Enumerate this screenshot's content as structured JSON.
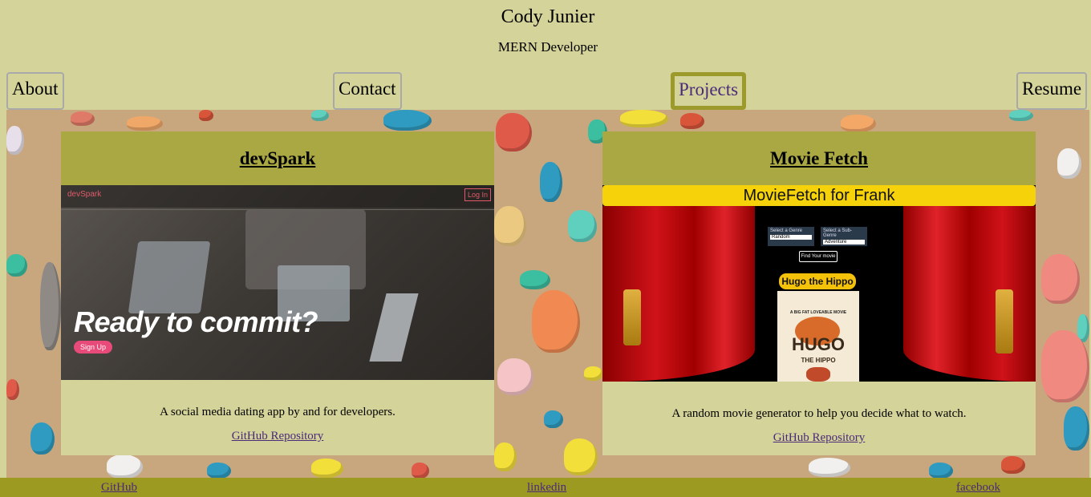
{
  "header": {
    "name": "Cody Junier",
    "role": "MERN Developer"
  },
  "nav": {
    "about": "About",
    "contact": "Contact",
    "projects": "Projects",
    "resume": "Resume"
  },
  "projects": [
    {
      "title": "devSpark",
      "image": {
        "logo": "devSpark",
        "login": "Log In",
        "headline": "Ready to commit?",
        "signup": "Sign Up"
      },
      "description": "A social media dating app by and for developers.",
      "link": "GitHub Repository"
    },
    {
      "title": "Movie Fetch",
      "image": {
        "banner": "MovieFetch for Frank",
        "genre_label": "Select a Genre",
        "genre_value": "Random",
        "subgenre_label": "Select a Sub-Genre",
        "subgenre_value": "Adventure",
        "button": "Find Your movie",
        "movie_title": "Hugo the Hippo",
        "poster_tag": "A BIG FAT LOVEABLE MOVIE",
        "poster_title": "HUGO",
        "poster_sub": "THE HIPPO"
      },
      "description": "A random movie generator to help you decide what to watch.",
      "link": "GitHub Repository"
    }
  ],
  "footer": {
    "github": "GitHub",
    "linkedin": "linkedin",
    "facebook": "facebook"
  },
  "colors": {
    "page_bg": "#d4d39a",
    "card_header": "#aaa843",
    "footer": "#9c9a20",
    "link": "#4b2a7a",
    "wall": "#c8a77e"
  }
}
